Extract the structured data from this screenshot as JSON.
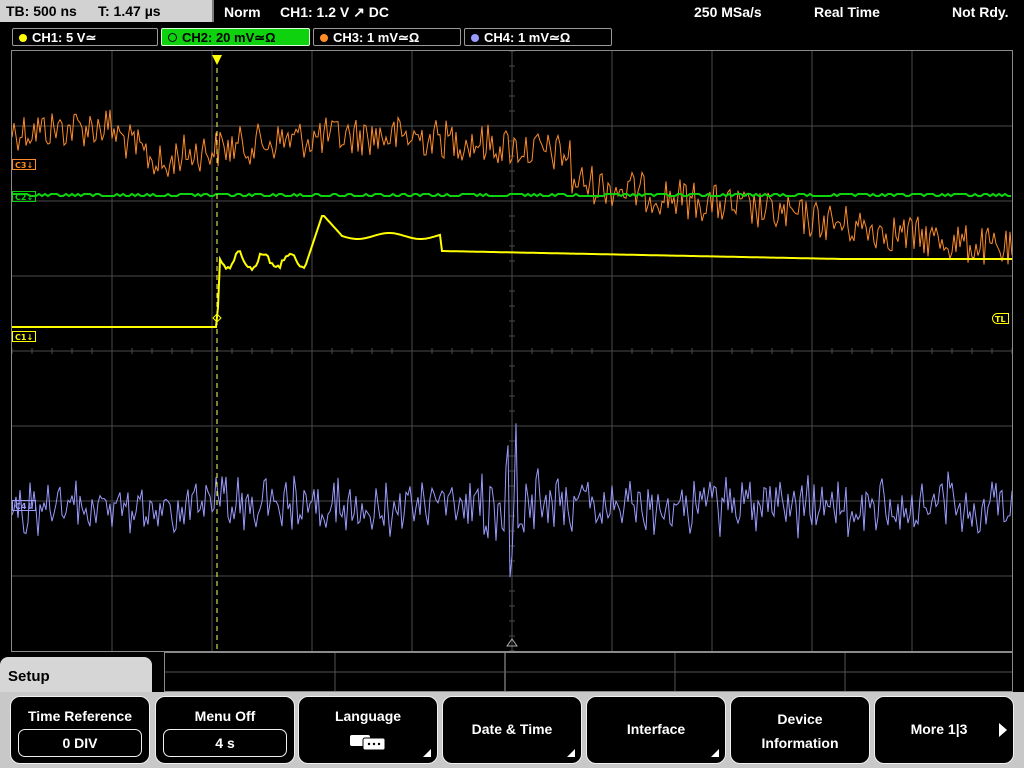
{
  "status": {
    "timebase": "TB: 500 ns",
    "trigger_time": "T: 1.47 µs",
    "mode": "Norm",
    "trigger_setup": "CH1: 1.2 V ↗ DC",
    "sample_rate": "250 MSa/s",
    "acquisition": "Real Time",
    "state": "Not Rdy."
  },
  "channels": [
    {
      "label": "CH1: 5 V≃",
      "color": "#ffff00"
    },
    {
      "label": "CH2: 20 mV≃Ω",
      "color": "#0fd20f",
      "active": true
    },
    {
      "label": "CH3: 1 mV≃Ω",
      "color": "#ff8c28"
    },
    {
      "label": "CH4: 1 mV≃Ω",
      "color": "#9a9aff"
    }
  ],
  "markers": {
    "c1": "C1↓",
    "c2": "C2↓",
    "c3": "C3↓",
    "c4": "C4↓",
    "trigger_level": "TL",
    "trigger_pos": "T"
  },
  "menu": {
    "tab": "Setup",
    "time_reference": {
      "label": "Time Reference",
      "value": "0 DIV"
    },
    "menu_off": {
      "label": "Menu Off",
      "value": "4 s"
    },
    "language": {
      "label": "Language",
      "icon": "speech-bubbles-icon"
    },
    "date_time": {
      "label": "Date & Time"
    },
    "interface": {
      "label": "Interface"
    },
    "device_info": {
      "label_line1": "Device",
      "label_line2": "Information"
    },
    "more": {
      "label": "More 1|3"
    }
  },
  "colors": {
    "ch1": "#ffff00",
    "ch2": "#0fd20f",
    "ch3": "#ff8c28",
    "ch4": "#9a9aff",
    "grid": "#4a4a4a"
  }
}
